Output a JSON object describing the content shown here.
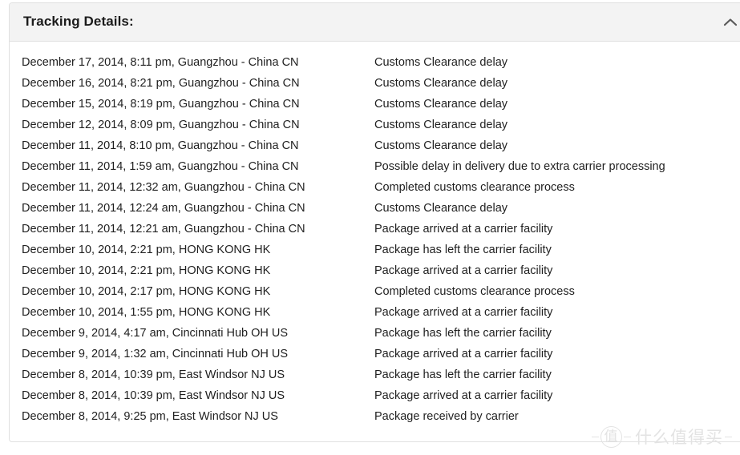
{
  "panel": {
    "title": "Tracking Details:",
    "collapse_icon": "chevron-up-icon"
  },
  "columns": {
    "datetime_header": "",
    "status_header": ""
  },
  "tracking_rows": [
    {
      "datetime": "December 17, 2014, 8:11 pm, Guangzhou - China CN",
      "status": "Customs Clearance delay"
    },
    {
      "datetime": "December 16, 2014, 8:21 pm, Guangzhou - China CN",
      "status": "Customs Clearance delay"
    },
    {
      "datetime": "December 15, 2014, 8:19 pm, Guangzhou - China CN",
      "status": "Customs Clearance delay"
    },
    {
      "datetime": "December 12, 2014, 8:09 pm, Guangzhou - China CN",
      "status": "Customs Clearance delay"
    },
    {
      "datetime": "December 11, 2014, 8:10 pm, Guangzhou - China CN",
      "status": "Customs Clearance delay"
    },
    {
      "datetime": "December 11, 2014, 1:59 am, Guangzhou - China CN",
      "status": "Possible delay in delivery due to extra carrier processing"
    },
    {
      "datetime": "December 11, 2014, 12:32 am, Guangzhou - China CN",
      "status": "Completed customs clearance process"
    },
    {
      "datetime": "December 11, 2014, 12:24 am, Guangzhou - China CN",
      "status": "Customs Clearance delay"
    },
    {
      "datetime": "December 11, 2014, 12:21 am, Guangzhou - China CN",
      "status": "Package arrived at a carrier facility"
    },
    {
      "datetime": "December 10, 2014, 2:21 pm, HONG KONG HK",
      "status": "Package has left the carrier facility"
    },
    {
      "datetime": "December 10, 2014, 2:21 pm, HONG KONG HK",
      "status": "Package arrived at a carrier facility"
    },
    {
      "datetime": "December 10, 2014, 2:17 pm, HONG KONG HK",
      "status": "Completed customs clearance process"
    },
    {
      "datetime": "December 10, 2014, 1:55 pm, HONG KONG HK",
      "status": "Package arrived at a carrier facility"
    },
    {
      "datetime": "December 9, 2014, 4:17 am, Cincinnati Hub OH US",
      "status": "Package has left the carrier facility"
    },
    {
      "datetime": "December 9, 2014, 1:32 am, Cincinnati Hub OH US",
      "status": "Package arrived at a carrier facility"
    },
    {
      "datetime": "December 8, 2014, 10:39 pm, East Windsor NJ US",
      "status": "Package has left the carrier facility"
    },
    {
      "datetime": "December 8, 2014, 10:39 pm, East Windsor NJ US",
      "status": "Package arrived at a carrier facility"
    },
    {
      "datetime": "December 8, 2014, 9:25 pm, East Windsor NJ US",
      "status": "Package received by carrier"
    }
  ],
  "watermark": {
    "badge": "值",
    "text": "什么值得买"
  },
  "colors": {
    "header_background": "#f3f3f3",
    "panel_border": "#e0e0e0",
    "text": "#1f1f1f",
    "watermark": "#e3e3e3"
  }
}
